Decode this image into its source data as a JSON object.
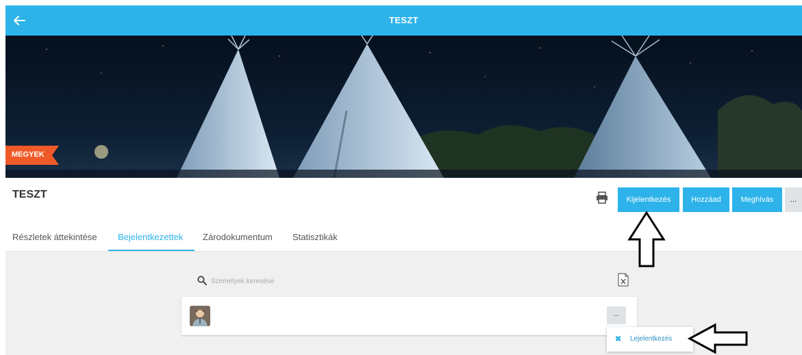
{
  "header": {
    "title": "TESZT",
    "back_icon": "arrow-left-icon"
  },
  "banner": {
    "ribbon_label": "MEGYEK",
    "ribbon_color": "#f05a28"
  },
  "event": {
    "title": "TESZT"
  },
  "actions": {
    "print_icon": "printer-icon",
    "checkout_label": "Kijelentkezés",
    "add_label": "Hozzáad",
    "invite_label": "Meghívás",
    "more_label": "..."
  },
  "tabs": [
    {
      "label": "Részletek áttekintése",
      "active": false
    },
    {
      "label": "Bejelentkezettek",
      "active": true
    },
    {
      "label": "Zárodokumentum",
      "active": false
    },
    {
      "label": "Statisztikák",
      "active": false
    }
  ],
  "search": {
    "placeholder": "Személyek keresése",
    "value": ""
  },
  "export_icon": "excel-icon",
  "people": [
    {
      "avatar": "user-avatar",
      "more_label": "..."
    }
  ],
  "dropdown": {
    "items": [
      {
        "icon": "close-icon",
        "label": "Lejelentkezés"
      }
    ]
  },
  "colors": {
    "accent": "#2db3ea",
    "more_bg": "#dfe3e6",
    "content_bg": "#f0f0f0"
  }
}
